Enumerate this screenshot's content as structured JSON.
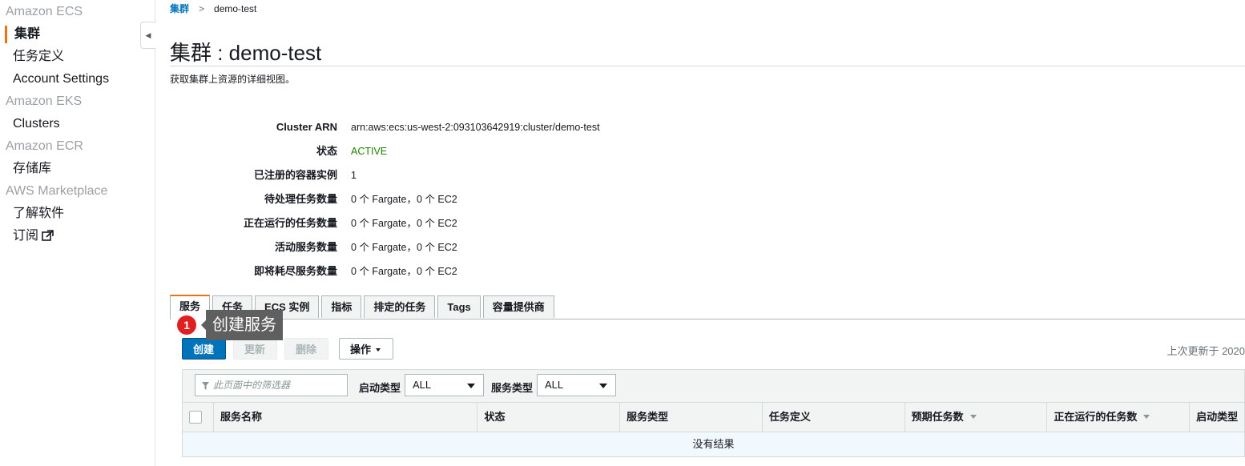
{
  "sidebar": {
    "entries": [
      {
        "type": "group",
        "label": "Amazon ECS"
      },
      {
        "type": "item",
        "label": "集群",
        "active": true
      },
      {
        "type": "item",
        "label": "任务定义"
      },
      {
        "type": "item",
        "label": "Account Settings"
      },
      {
        "type": "group",
        "label": "Amazon EKS"
      },
      {
        "type": "item",
        "label": "Clusters"
      },
      {
        "type": "group",
        "label": "Amazon ECR"
      },
      {
        "type": "item",
        "label": "存储库"
      },
      {
        "type": "group",
        "label": "AWS Marketplace"
      },
      {
        "type": "item",
        "label": "了解软件"
      },
      {
        "type": "item",
        "label": "订阅",
        "external": true
      }
    ]
  },
  "breadcrumb": {
    "parent": "集群",
    "current": "demo-test"
  },
  "page": {
    "title": "集群 : demo-test",
    "subtitle": "获取集群上资源的详细视图。"
  },
  "details": [
    {
      "label": "Cluster ARN",
      "value": "arn:aws:ecs:us-west-2:093103642919:cluster/demo-test"
    },
    {
      "label": "状态",
      "value": "ACTIVE",
      "status": "green"
    },
    {
      "label": "已注册的容器实例",
      "value": "1"
    },
    {
      "label": "待处理任务数量",
      "value": "0 个 Fargate，0 个 EC2"
    },
    {
      "label": "正在运行的任务数量",
      "value": "0 个 Fargate，0 个 EC2"
    },
    {
      "label": "活动服务数量",
      "value": "0 个 Fargate，0 个 EC2"
    },
    {
      "label": "即将耗尽服务数量",
      "value": "0 个 Fargate，0 个 EC2"
    }
  ],
  "tabs": [
    {
      "label": "服务",
      "active": true
    },
    {
      "label": "任务"
    },
    {
      "label": "ECS 实例"
    },
    {
      "label": "指标"
    },
    {
      "label": "排定的任务"
    },
    {
      "label": "Tags"
    },
    {
      "label": "容量提供商"
    }
  ],
  "tooltip": {
    "number": "1",
    "text": "创建服务"
  },
  "toolbar": {
    "create_label": "创建",
    "update_label": "更新",
    "delete_label": "删除",
    "actions_label": "操作",
    "last_updated": "上次更新于 2020"
  },
  "filter": {
    "placeholder": "此页面中的筛选器",
    "launch_type_label": "启动类型",
    "launch_type_value": "ALL",
    "service_type_label": "服务类型",
    "service_type_value": "ALL"
  },
  "table": {
    "columns": [
      {
        "label": "服务名称"
      },
      {
        "label": "状态"
      },
      {
        "label": "服务类型"
      },
      {
        "label": "任务定义"
      },
      {
        "label": "预期任务数",
        "sortable": true
      },
      {
        "label": "正在运行的任务数",
        "sortable": true
      },
      {
        "label": "启动类型"
      }
    ],
    "empty_text": "没有结果"
  },
  "colors": {
    "accent": "#ec7211",
    "primary": "#0073bb",
    "active_status": "#1d8102"
  }
}
